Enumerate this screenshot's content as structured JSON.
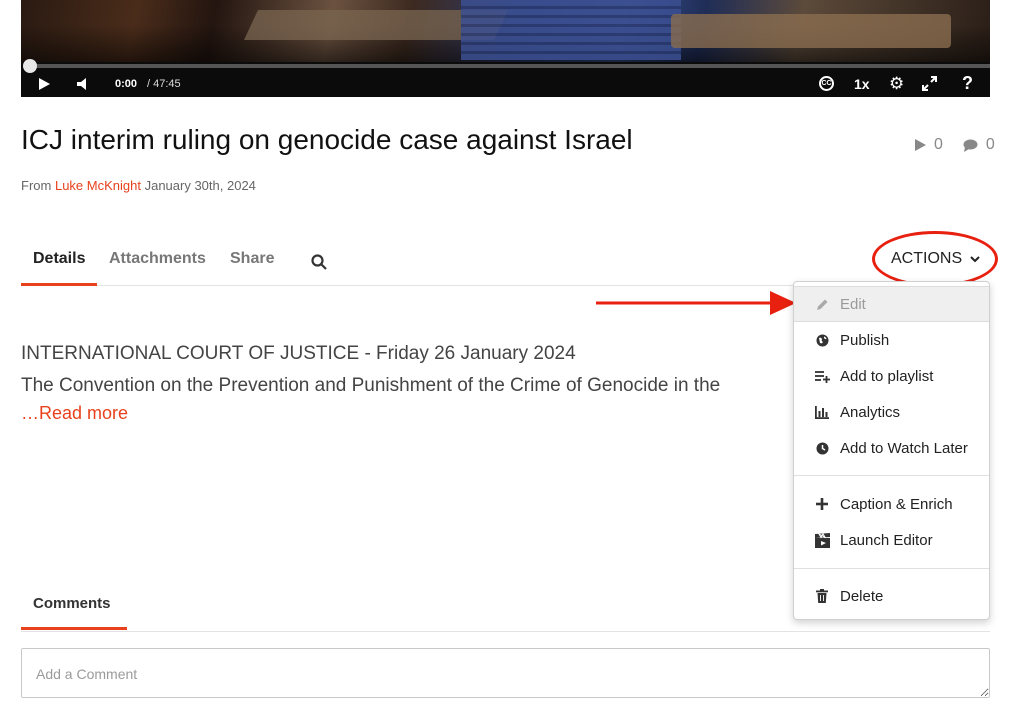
{
  "player": {
    "current_time": "0:00",
    "total_time": "/ 47:45",
    "speed": "1x",
    "cc_label": "CC",
    "help_label": "?",
    "progress": 0,
    "icons": [
      "play-icon",
      "volume-icon",
      "closed-captions-icon",
      "gear-icon",
      "fullscreen-icon",
      "help-icon"
    ]
  },
  "media": {
    "title": "ICJ interim ruling on genocide case against Israel",
    "plays": "0",
    "comments_count": "0",
    "from_label": "From",
    "author": "Luke McKnight",
    "date": "January 30th, 2024"
  },
  "tabs": {
    "items": [
      "Details",
      "Attachments",
      "Share"
    ],
    "active": "Details",
    "actions_label": "ACTIONS"
  },
  "description": {
    "line1": "INTERNATIONAL COURT OF JUSTICE - Friday 26 January 2024",
    "line2": "The Convention on the Prevention and Punishment of the Crime of Genocide in the",
    "read_more": "…Read more"
  },
  "actions_menu": {
    "items": [
      {
        "label": "Edit",
        "icon": "pencil-icon",
        "disabled": true
      },
      {
        "label": "Publish",
        "icon": "globe-icon"
      },
      {
        "label": "Add to playlist",
        "icon": "playlist-add-icon"
      },
      {
        "label": "Analytics",
        "icon": "bar-chart-icon"
      },
      {
        "label": "Add to Watch Later",
        "icon": "clock-icon"
      },
      {
        "label": "Caption & Enrich",
        "icon": "plus-icon"
      },
      {
        "label": "Launch Editor",
        "icon": "clapperboard-icon"
      },
      {
        "label": "Delete",
        "icon": "trash-icon"
      }
    ]
  },
  "comments": {
    "tab_label": "Comments",
    "placeholder": "Add a Comment"
  },
  "colors": {
    "accent": "#e8411c",
    "annotation": "#e8200f"
  }
}
